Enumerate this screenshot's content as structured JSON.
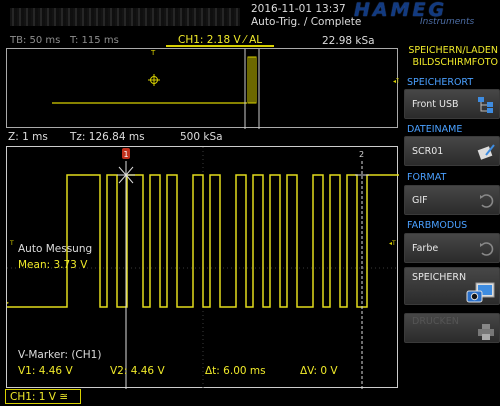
{
  "header": {
    "datetime": "2016-11-01 13:37",
    "trigger_status": "Auto-Trig. / Complete",
    "logo": "HAMEG",
    "logo_sub": "Instruments"
  },
  "overview": {
    "tb": "TB: 50 ms",
    "t": "T: 115 ms",
    "channel": "CH1: 2.18 V ⁄ AL",
    "samplerate": "22.98 kSa"
  },
  "zoom": {
    "z": "Z: 1 ms",
    "tz": "Tz: 126.84 ms",
    "samplerate": "500 kSa"
  },
  "measurement": {
    "title": "Auto Messung",
    "mean": "Mean: 3.73 V"
  },
  "markers": {
    "title": "V-Marker: (CH1)",
    "v1": "V1: 4.46 V",
    "v2": "V2: 4.46 V",
    "dt": "Δt: 6.00 ms",
    "dv": "ΔV: 0 V",
    "marker1_label": "1",
    "marker2_label": "2"
  },
  "channel_badge": "CH1: 1 V ≅",
  "panel": {
    "title_line1": "SPEICHERN/LADEN",
    "title_line2": "BILDSCHIRMFOTO",
    "speicherort_label": "SPEICHERORT",
    "speicherort_value": "Front USB",
    "dateiname_label": "DATEINAME",
    "dateiname_value": "SCR01",
    "format_label": "FORMAT",
    "format_value": "GIF",
    "farbmodus_label": "FARBMODUS",
    "farbmodus_value": "Farbe",
    "speichern_label": "SPEICHERN",
    "drucken_label": "DRUCKEN"
  },
  "colors": {
    "trace": "#e2dc1c",
    "accent_blue": "#4aa0ff",
    "panel_yellow": "#f0ea2a"
  }
}
